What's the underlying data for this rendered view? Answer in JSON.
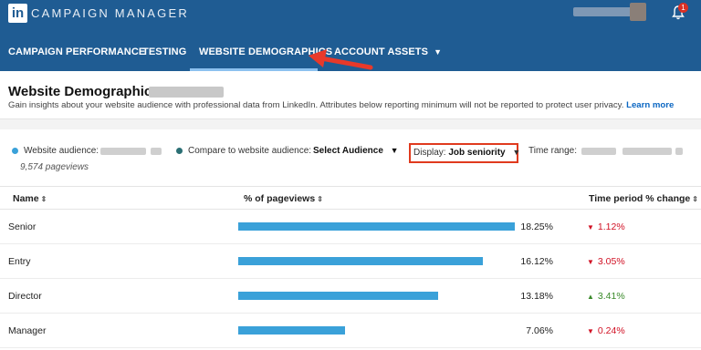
{
  "brand": {
    "logo_text": "in",
    "app_title": "CAMPAIGN MANAGER",
    "notification_count": "1"
  },
  "nav": {
    "tabs": [
      {
        "label": "CAMPAIGN PERFORMANCE"
      },
      {
        "label": "TESTING"
      },
      {
        "label": "WEBSITE DEMOGRAPHICS",
        "active": true
      },
      {
        "label": "ACCOUNT ASSETS"
      }
    ]
  },
  "header": {
    "title": "Website Demographics:",
    "subtitle": "Gain insights about your website audience with professional data from LinkedIn. Attributes below reporting minimum will not be reported to protect user privacy.",
    "learn_more": "Learn more"
  },
  "filters": {
    "audience_label": "Website audience:",
    "pageviews": "9,574 pageviews",
    "compare_label": "Compare to website audience:",
    "compare_value": "Select Audience",
    "display_label": "Display:",
    "display_value": "Job seniority",
    "time_range_label": "Time range:",
    "colors": {
      "audience_dot": "#3aa1d9",
      "compare_dot": "#2b6f74"
    }
  },
  "table": {
    "headers": {
      "name": "Name",
      "pageviews": "% of pageviews",
      "change": "Time period % change"
    },
    "rows": [
      {
        "name": "Senior",
        "pct_text": "18.25%",
        "pct": 18.25,
        "change": "1.12%",
        "direction": "down"
      },
      {
        "name": "Entry",
        "pct_text": "16.12%",
        "pct": 16.12,
        "change": "3.05%",
        "direction": "down"
      },
      {
        "name": "Director",
        "pct_text": "13.18%",
        "pct": 13.18,
        "change": "3.41%",
        "direction": "up"
      },
      {
        "name": "Manager",
        "pct_text": "7.06%",
        "pct": 7.06,
        "change": "0.24%",
        "direction": "down"
      }
    ],
    "colors": {
      "bar": "#3aa1d9",
      "down": "#d11124",
      "up": "#3a8a2a"
    }
  }
}
